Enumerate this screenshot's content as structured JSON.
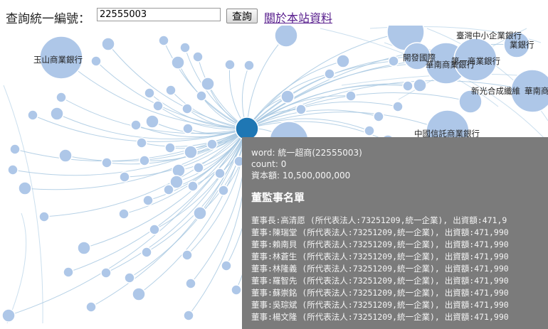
{
  "search": {
    "label": "查詢統一編號：",
    "input_value": "22555003",
    "button_label": "查詢",
    "about_link": "關於本站資料"
  },
  "graph": {
    "node_labels": [
      "玉山商業銀行",
      "臺灣中小企業銀行",
      "業銀行",
      "開發國際",
      "華南商業銀行",
      "第一商業銀行",
      "新光合成纖維",
      "華南商",
      "中國信託商業銀行"
    ],
    "colors": {
      "node": "#aec7e8",
      "focus_node": "#1f77b4",
      "edge": "#a9c9e2",
      "tooltip_bg": "#7b7b7b"
    }
  },
  "tooltip": {
    "word": "word: 統一超商(22555003)",
    "count": "count: 0",
    "capital": "資本額: 10,500,000,000",
    "title": "董監事名單",
    "directors": [
      "董事長:高清愿 (所代表法人:73251209,統一企業), 出資額:471,9",
      "董事:陳瑞堂 (所代表法人:73251209,統一企業), 出資額:471,990",
      "董事:賴南貝 (所代表法人:73251209,統一企業), 出資額:471,990",
      "董事:林蒼生 (所代表法人:73251209,統一企業), 出資額:471,990",
      "董事:林隆義 (所代表法人:73251209,統一企業), 出資額:471,990",
      "董事:羅智先 (所代表法人:73251209,統一企業), 出資額:471,990",
      "董事:蘇崇銘 (所代表法人:73251209,統一企業), 出資額:471,990",
      "董事:吳琮斌 (所代表法人:73251209,統一企業), 出資額:471,990",
      "董事:楊文隆 (所代表法人:73251209,統一企業), 出資額:471,990"
    ]
  }
}
